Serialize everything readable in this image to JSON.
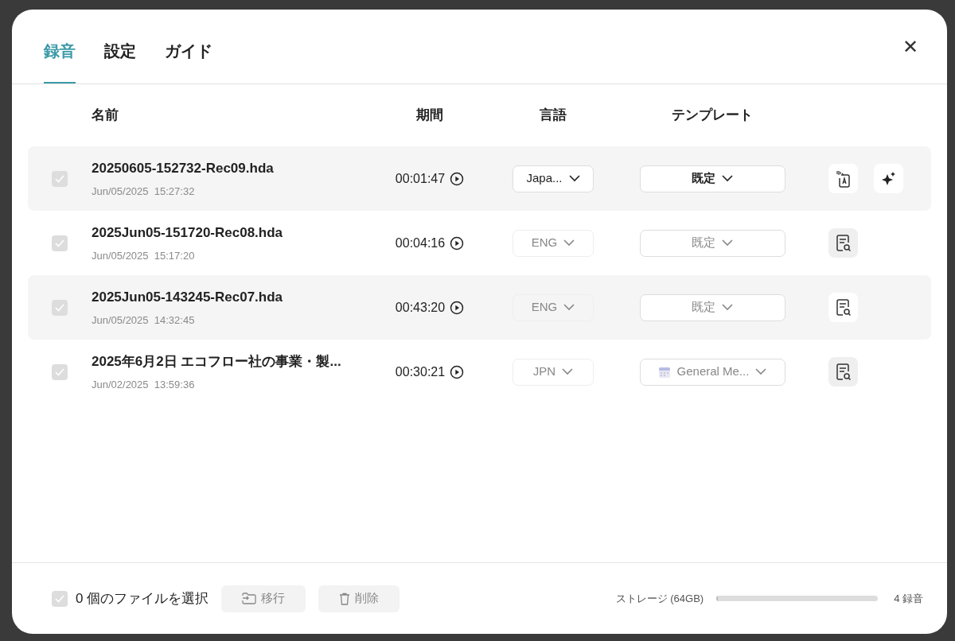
{
  "tabs": [
    {
      "label": "録音",
      "selected": true
    },
    {
      "label": "設定",
      "selected": false
    },
    {
      "label": "ガイド",
      "selected": false
    }
  ],
  "close": "✕",
  "table": {
    "columns": [
      "名前",
      "期間",
      "言語",
      "テンプレート"
    ],
    "rows": [
      {
        "name": "20250605-152732-Rec09.hda",
        "date": "Jun/05/2025  15:27:32",
        "duration": "00:01:47",
        "language": "Japa...",
        "language_disabled": false,
        "template": "既定",
        "template_disabled": false,
        "highlighted": true,
        "checked": true,
        "actions": [
          {
            "kind": "transcribe"
          },
          {
            "kind": "ai"
          }
        ]
      },
      {
        "name": "2025Jun05-151720-Rec08.hda",
        "date": "Jun/05/2025  15:17:20",
        "duration": "00:04:16",
        "language": "ENG",
        "language_disabled": true,
        "template": "既定",
        "template_disabled": true,
        "highlighted": false,
        "checked": true,
        "actions": [
          {
            "kind": "summary"
          }
        ]
      },
      {
        "name": "2025Jun05-143245-Rec07.hda",
        "date": "Jun/05/2025  14:32:45",
        "duration": "00:43:20",
        "language": "ENG",
        "language_disabled": true,
        "template": "既定",
        "template_disabled": true,
        "highlighted": true,
        "checked": true,
        "actions": [
          {
            "kind": "summary"
          }
        ]
      },
      {
        "name": "2025年6月2日 エコフロー社の事業・製...",
        "date": "Jun/02/2025  13:59:36",
        "duration": "00:30:21",
        "language": "JPN",
        "language_disabled": true,
        "template": "General Me...",
        "template_icon": true,
        "template_disabled": true,
        "highlighted": false,
        "checked": true,
        "actions": [
          {
            "kind": "summary"
          }
        ]
      }
    ]
  },
  "footer": {
    "select_all_checked": true,
    "selection": "0 個のファイルを選択",
    "buttons": [
      {
        "label": "移行",
        "kind": "move"
      },
      {
        "label": "削除",
        "kind": "delete"
      }
    ],
    "storage_label": "ストレージ (64GB)",
    "storage": {
      "level": 0.01
    },
    "count": "4 録音"
  }
}
